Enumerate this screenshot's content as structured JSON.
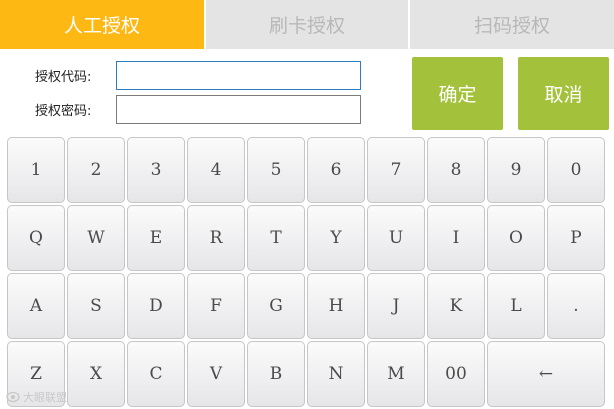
{
  "tabs": [
    {
      "label": "人工授权",
      "active": true
    },
    {
      "label": "刷卡授权",
      "active": false
    },
    {
      "label": "扫码授权",
      "active": false
    }
  ],
  "form": {
    "code_label": "授权代码:",
    "code_value": "",
    "password_label": "授权密码:",
    "password_value": ""
  },
  "actions": {
    "confirm_label": "确定",
    "cancel_label": "取消"
  },
  "keyboard": {
    "rows": [
      [
        "1",
        "2",
        "3",
        "4",
        "5",
        "6",
        "7",
        "8",
        "9",
        "0"
      ],
      [
        "Q",
        "W",
        "E",
        "R",
        "T",
        "Y",
        "U",
        "I",
        "O",
        "P"
      ],
      [
        "A",
        "S",
        "D",
        "F",
        "G",
        "H",
        "J",
        "K",
        "L",
        "."
      ],
      [
        "Z",
        "X",
        "C",
        "V",
        "B",
        "N",
        "M",
        "00",
        "←"
      ]
    ]
  },
  "watermark": {
    "text": "大眼联盟"
  },
  "colors": {
    "active_tab": "#fdb813",
    "inactive_tab": "#e4e4e4",
    "action_button": "#a3c13a"
  }
}
